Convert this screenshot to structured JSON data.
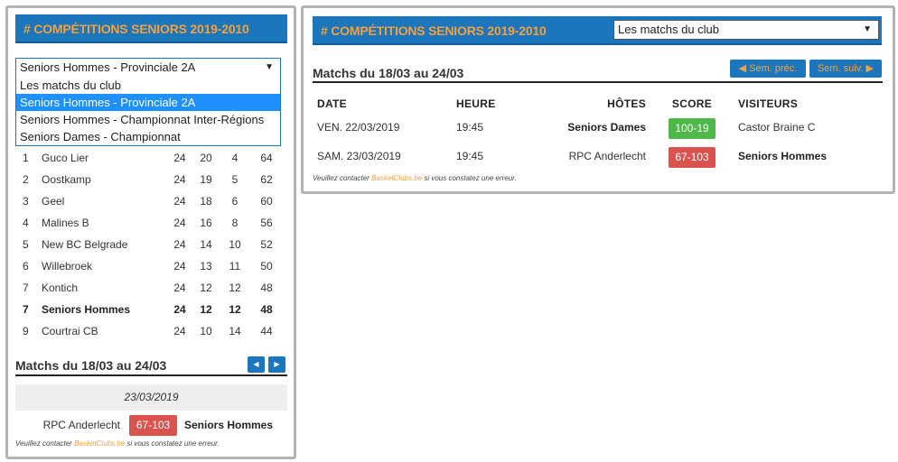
{
  "left": {
    "banner": "# COMPÉTITIONS SENIORS 2019-2010",
    "select_value": "Seniors Hommes - Provinciale 2A",
    "select_arrow": "▼",
    "dropdown_options": [
      {
        "label": "Les matchs du club",
        "selected": false
      },
      {
        "label": "Seniors Hommes - Provinciale 2A",
        "selected": true
      },
      {
        "label": "Seniors Hommes - Championnat Inter-Régions",
        "selected": false
      },
      {
        "label": "Seniors Dames - Championnat",
        "selected": false
      }
    ],
    "ranking": [
      {
        "pos": "1",
        "team": "Guco Lier",
        "played": "24",
        "won": "20",
        "lost": "4",
        "points": "64",
        "bold": false
      },
      {
        "pos": "2",
        "team": "Oostkamp",
        "played": "24",
        "won": "19",
        "lost": "5",
        "points": "62",
        "bold": false
      },
      {
        "pos": "3",
        "team": "Geel",
        "played": "24",
        "won": "18",
        "lost": "6",
        "points": "60",
        "bold": false
      },
      {
        "pos": "4",
        "team": "Malines B",
        "played": "24",
        "won": "16",
        "lost": "8",
        "points": "56",
        "bold": false
      },
      {
        "pos": "5",
        "team": "New BC Belgrade",
        "played": "24",
        "won": "14",
        "lost": "10",
        "points": "52",
        "bold": false
      },
      {
        "pos": "6",
        "team": "Willebroek",
        "played": "24",
        "won": "13",
        "lost": "11",
        "points": "50",
        "bold": false
      },
      {
        "pos": "7",
        "team": "Kontich",
        "played": "24",
        "won": "12",
        "lost": "12",
        "points": "48",
        "bold": false
      },
      {
        "pos": "7",
        "team": "Seniors Hommes",
        "played": "24",
        "won": "12",
        "lost": "12",
        "points": "48",
        "bold": true
      },
      {
        "pos": "9",
        "team": "Courtrai CB",
        "played": "24",
        "won": "10",
        "lost": "14",
        "points": "44",
        "bold": false
      }
    ],
    "matches_title": "Matchs du 18/03 au 24/03",
    "prev_icon": "◀",
    "next_icon": "▶",
    "match_date": "23/03/2019",
    "match": {
      "home": "RPC Anderlecht",
      "score": "67-103",
      "away": "Seniors Hommes"
    },
    "note_prefix": "Veuillez contacter ",
    "note_link": "BasketClubs.be",
    "note_suffix": " si vous constatez une erreur."
  },
  "right": {
    "banner": "# COMPÉTITIONS SENIORS 2019-2010",
    "select_value": "Les matchs du club",
    "select_arrow": "▼",
    "matches_title": "Matchs du 18/03 au 24/03",
    "prev_label": "◀ Sem. préc.",
    "next_label": "Sem. suiv. ▶",
    "headers": {
      "date": "DATE",
      "time": "HEURE",
      "home": "HÔTES",
      "score": "SCORE",
      "away": "VISITEURS"
    },
    "rows": [
      {
        "date": "VEN. 22/03/2019",
        "time": "19:45",
        "home": "Seniors Dames",
        "home_bold": true,
        "score": "100-19",
        "result": "win",
        "away": "Castor Braine C",
        "away_bold": false
      },
      {
        "date": "SAM. 23/03/2019",
        "time": "19:45",
        "home": "RPC Anderlecht",
        "home_bold": false,
        "score": "67-103",
        "result": "loss",
        "away": "Seniors Hommes",
        "away_bold": true
      }
    ],
    "note_prefix": "Veuillez contacter ",
    "note_link": "BasketClubs.be",
    "note_suffix": " si vous constatez une erreur."
  },
  "colors": {
    "brand_blue": "#1b76bc",
    "accent_orange": "#f6a03c",
    "win_green": "#4fb84a",
    "loss_red": "#d9534f",
    "selected_option": "#1e90ff"
  }
}
